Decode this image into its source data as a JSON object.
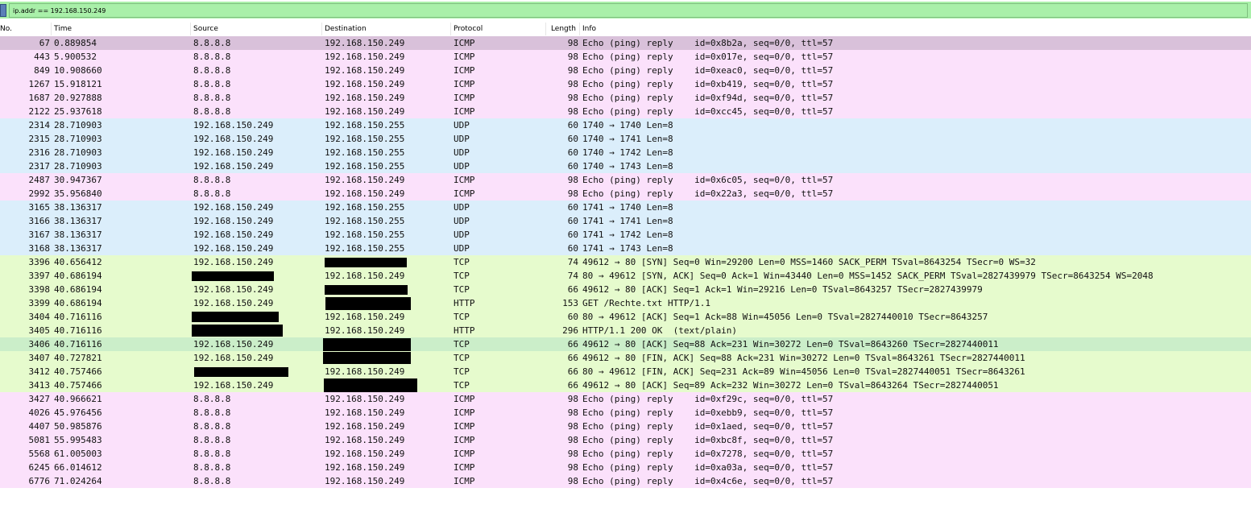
{
  "filter": {
    "value": "ip.addr == 192.168.150.249"
  },
  "columns": [
    "No.",
    "Time",
    "Source",
    "Destination",
    "Protocol",
    "Length",
    "Info"
  ],
  "colors": {
    "icmp": "#fbe1fb",
    "udp": "#dbeefb",
    "tcp": "#e6fbcd",
    "selected": "#d9c1da",
    "marked": "#cbeec9"
  },
  "packets": [
    {
      "no": "67",
      "time": "0.889854",
      "src": "8.8.8.8",
      "dst": "192.168.150.249",
      "proto": "ICMP",
      "len": "98",
      "info": "Echo (ping) reply    id=0x8b2a, seq=0/0, ttl=57",
      "color": "#d9c1da"
    },
    {
      "no": "443",
      "time": "5.900532",
      "src": "8.8.8.8",
      "dst": "192.168.150.249",
      "proto": "ICMP",
      "len": "98",
      "info": "Echo (ping) reply    id=0x017e, seq=0/0, ttl=57",
      "color": "#fbe1fb"
    },
    {
      "no": "849",
      "time": "10.908660",
      "src": "8.8.8.8",
      "dst": "192.168.150.249",
      "proto": "ICMP",
      "len": "98",
      "info": "Echo (ping) reply    id=0xeac0, seq=0/0, ttl=57",
      "color": "#fbe1fb"
    },
    {
      "no": "1267",
      "time": "15.918121",
      "src": "8.8.8.8",
      "dst": "192.168.150.249",
      "proto": "ICMP",
      "len": "98",
      "info": "Echo (ping) reply    id=0xb419, seq=0/0, ttl=57",
      "color": "#fbe1fb"
    },
    {
      "no": "1687",
      "time": "20.927888",
      "src": "8.8.8.8",
      "dst": "192.168.150.249",
      "proto": "ICMP",
      "len": "98",
      "info": "Echo (ping) reply    id=0xf94d, seq=0/0, ttl=57",
      "color": "#fbe1fb"
    },
    {
      "no": "2122",
      "time": "25.937618",
      "src": "8.8.8.8",
      "dst": "192.168.150.249",
      "proto": "ICMP",
      "len": "98",
      "info": "Echo (ping) reply    id=0xcc45, seq=0/0, ttl=57",
      "color": "#fbe1fb"
    },
    {
      "no": "2314",
      "time": "28.710903",
      "src": "192.168.150.249",
      "dst": "192.168.150.255",
      "proto": "UDP",
      "len": "60",
      "info": "1740 → 1740 Len=8",
      "color": "#dbeefb"
    },
    {
      "no": "2315",
      "time": "28.710903",
      "src": "192.168.150.249",
      "dst": "192.168.150.255",
      "proto": "UDP",
      "len": "60",
      "info": "1740 → 1741 Len=8",
      "color": "#dbeefb"
    },
    {
      "no": "2316",
      "time": "28.710903",
      "src": "192.168.150.249",
      "dst": "192.168.150.255",
      "proto": "UDP",
      "len": "60",
      "info": "1740 → 1742 Len=8",
      "color": "#dbeefb"
    },
    {
      "no": "2317",
      "time": "28.710903",
      "src": "192.168.150.249",
      "dst": "192.168.150.255",
      "proto": "UDP",
      "len": "60",
      "info": "1740 → 1743 Len=8",
      "color": "#dbeefb"
    },
    {
      "no": "2487",
      "time": "30.947367",
      "src": "8.8.8.8",
      "dst": "192.168.150.249",
      "proto": "ICMP",
      "len": "98",
      "info": "Echo (ping) reply    id=0x6c05, seq=0/0, ttl=57",
      "color": "#fbe1fb"
    },
    {
      "no": "2992",
      "time": "35.956840",
      "src": "8.8.8.8",
      "dst": "192.168.150.249",
      "proto": "ICMP",
      "len": "98",
      "info": "Echo (ping) reply    id=0x22a3, seq=0/0, ttl=57",
      "color": "#fbe1fb"
    },
    {
      "no": "3165",
      "time": "38.136317",
      "src": "192.168.150.249",
      "dst": "192.168.150.255",
      "proto": "UDP",
      "len": "60",
      "info": "1741 → 1740 Len=8",
      "color": "#dbeefb"
    },
    {
      "no": "3166",
      "time": "38.136317",
      "src": "192.168.150.249",
      "dst": "192.168.150.255",
      "proto": "UDP",
      "len": "60",
      "info": "1741 → 1741 Len=8",
      "color": "#dbeefb"
    },
    {
      "no": "3167",
      "time": "38.136317",
      "src": "192.168.150.249",
      "dst": "192.168.150.255",
      "proto": "UDP",
      "len": "60",
      "info": "1741 → 1742 Len=8",
      "color": "#dbeefb"
    },
    {
      "no": "3168",
      "time": "38.136317",
      "src": "192.168.150.249",
      "dst": "192.168.150.255",
      "proto": "UDP",
      "len": "60",
      "info": "1741 → 1743 Len=8",
      "color": "#dbeefb"
    },
    {
      "no": "3396",
      "time": "40.656412",
      "src": "192.168.150.249",
      "dst": "",
      "proto": "TCP",
      "len": "74",
      "info": "49612 → 80 [SYN] Seq=0 Win=29200 Len=0 MSS=1460 SACK_PERM TSval=8643254 TSecr=0 WS=32",
      "color": "#e6fbcd"
    },
    {
      "no": "3397",
      "time": "40.686194",
      "src": "",
      "dst": "192.168.150.249",
      "proto": "TCP",
      "len": "74",
      "info": "80 → 49612 [SYN, ACK] Seq=0 Ack=1 Win=43440 Len=0 MSS=1452 SACK_PERM TSval=2827439979 TSecr=8643254 WS=2048",
      "color": "#e6fbcd"
    },
    {
      "no": "3398",
      "time": "40.686194",
      "src": "192.168.150.249",
      "dst": "",
      "proto": "TCP",
      "len": "66",
      "info": "49612 → 80 [ACK] Seq=1 Ack=1 Win=29216 Len=0 TSval=8643257 TSecr=2827439979",
      "color": "#e6fbcd"
    },
    {
      "no": "3399",
      "time": "40.686194",
      "src": "192.168.150.249",
      "dst": "",
      "proto": "HTTP",
      "len": "153",
      "info": "GET /Rechte.txt HTTP/1.1",
      "color": "#e6fbcd"
    },
    {
      "no": "3404",
      "time": "40.716116",
      "src": "",
      "dst": "192.168.150.249",
      "proto": "TCP",
      "len": "60",
      "info": "80 → 49612 [ACK] Seq=1 Ack=88 Win=45056 Len=0 TSval=2827440010 TSecr=8643257",
      "color": "#e6fbcd"
    },
    {
      "no": "3405",
      "time": "40.716116",
      "src": "",
      "dst": "192.168.150.249",
      "proto": "HTTP",
      "len": "296",
      "info": "HTTP/1.1 200 OK  (text/plain)",
      "color": "#e6fbcd"
    },
    {
      "no": "3406",
      "time": "40.716116",
      "src": "192.168.150.249",
      "dst": "",
      "proto": "TCP",
      "len": "66",
      "info": "49612 → 80 [ACK] Seq=88 Ack=231 Win=30272 Len=0 TSval=8643260 TSecr=2827440011",
      "color": "#cbeec9"
    },
    {
      "no": "3407",
      "time": "40.727821",
      "src": "192.168.150.249",
      "dst": "",
      "proto": "TCP",
      "len": "66",
      "info": "49612 → 80 [FIN, ACK] Seq=88 Ack=231 Win=30272 Len=0 TSval=8643261 TSecr=2827440011",
      "color": "#e6fbcd"
    },
    {
      "no": "3412",
      "time": "40.757466",
      "src": "",
      "dst": "192.168.150.249",
      "proto": "TCP",
      "len": "66",
      "info": "80 → 49612 [FIN, ACK] Seq=231 Ack=89 Win=45056 Len=0 TSval=2827440051 TSecr=8643261",
      "color": "#e6fbcd"
    },
    {
      "no": "3413",
      "time": "40.757466",
      "src": "192.168.150.249",
      "dst": "",
      "proto": "TCP",
      "len": "66",
      "info": "49612 → 80 [ACK] Seq=89 Ack=232 Win=30272 Len=0 TSval=8643264 TSecr=2827440051",
      "color": "#e6fbcd"
    },
    {
      "no": "3427",
      "time": "40.966621",
      "src": "8.8.8.8",
      "dst": "192.168.150.249",
      "proto": "ICMP",
      "len": "98",
      "info": "Echo (ping) reply    id=0xf29c, seq=0/0, ttl=57",
      "color": "#fbe1fb"
    },
    {
      "no": "4026",
      "time": "45.976456",
      "src": "8.8.8.8",
      "dst": "192.168.150.249",
      "proto": "ICMP",
      "len": "98",
      "info": "Echo (ping) reply    id=0xebb9, seq=0/0, ttl=57",
      "color": "#fbe1fb"
    },
    {
      "no": "4407",
      "time": "50.985876",
      "src": "8.8.8.8",
      "dst": "192.168.150.249",
      "proto": "ICMP",
      "len": "98",
      "info": "Echo (ping) reply    id=0x1aed, seq=0/0, ttl=57",
      "color": "#fbe1fb"
    },
    {
      "no": "5081",
      "time": "55.995483",
      "src": "8.8.8.8",
      "dst": "192.168.150.249",
      "proto": "ICMP",
      "len": "98",
      "info": "Echo (ping) reply    id=0xbc8f, seq=0/0, ttl=57",
      "color": "#fbe1fb"
    },
    {
      "no": "5568",
      "time": "61.005003",
      "src": "8.8.8.8",
      "dst": "192.168.150.249",
      "proto": "ICMP",
      "len": "98",
      "info": "Echo (ping) reply    id=0x7278, seq=0/0, ttl=57",
      "color": "#fbe1fb"
    },
    {
      "no": "6245",
      "time": "66.014612",
      "src": "8.8.8.8",
      "dst": "192.168.150.249",
      "proto": "ICMP",
      "len": "98",
      "info": "Echo (ping) reply    id=0xa03a, seq=0/0, ttl=57",
      "color": "#fbe1fb"
    },
    {
      "no": "6776",
      "time": "71.024264",
      "src": "8.8.8.8",
      "dst": "192.168.150.249",
      "proto": "ICMP",
      "len": "98",
      "info": "Echo (ping) reply    id=0x4c6e, seq=0/0, ttl=57",
      "color": "#fbe1fb"
    }
  ]
}
